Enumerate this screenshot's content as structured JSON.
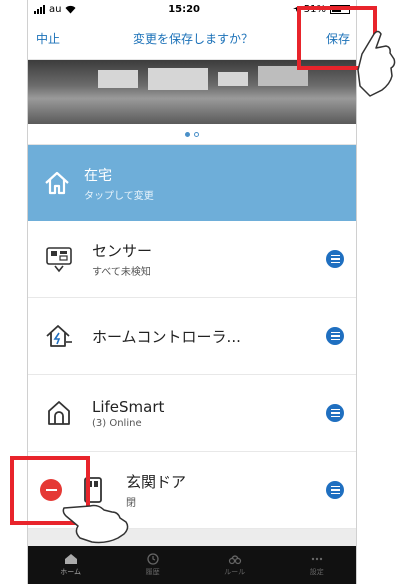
{
  "status_bar": {
    "carrier": "au",
    "time": "15:20",
    "battery": "51%"
  },
  "nav": {
    "cancel_label": "中止",
    "title": "変更を保存しますか？",
    "save_label": "保存"
  },
  "carousel": {
    "page_count": 2,
    "active_page": 1
  },
  "home_mode": {
    "title": "在宅",
    "subtitle": "タップして変更"
  },
  "devices": [
    {
      "name": "センサー",
      "status": "すべて未検知",
      "icon": "sensor-icon"
    },
    {
      "name": "ホームコントローラ...",
      "status": "",
      "icon": "home-controller-icon"
    },
    {
      "name": "LifeSmart",
      "status": "(3) Online",
      "icon": "lifesmart-icon"
    },
    {
      "name": "玄関ドア",
      "status": "閉",
      "icon": "door-sensor-icon"
    }
  ],
  "tabs": [
    {
      "label": "ホーム",
      "icon": "home-icon"
    },
    {
      "label": "履歴",
      "icon": "history-icon"
    },
    {
      "label": "ルール",
      "icon": "rules-icon"
    },
    {
      "label": "設定",
      "icon": "settings-icon"
    }
  ],
  "accent_colors": {
    "blue": "#1b71b8",
    "home_bg": "#6eaed9",
    "delete_red": "#e53935",
    "highlight_red": "#e8242b"
  }
}
